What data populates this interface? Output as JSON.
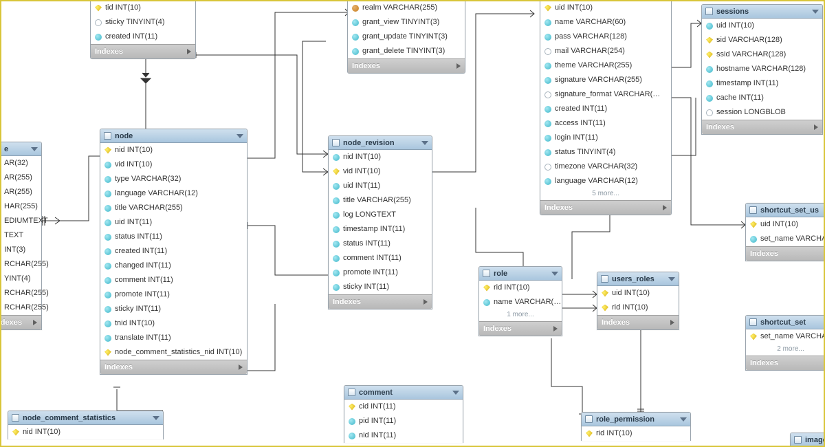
{
  "indexes_label": "Indexes",
  "tables": {
    "node_top": {
      "columns": [
        {
          "kind": "pk",
          "text": "tid INT(10)"
        },
        {
          "kind": "nul",
          "text": "sticky TINYINT(4)"
        },
        {
          "kind": "col",
          "text": "created INT(11)"
        }
      ]
    },
    "left_partial": {
      "title": "e",
      "columns": [
        {
          "kind": "col",
          "text": "AR(32)"
        },
        {
          "kind": "col",
          "text": "AR(255)"
        },
        {
          "kind": "col",
          "text": "AR(255)"
        },
        {
          "kind": "col",
          "text": "HAR(255)"
        },
        {
          "kind": "col",
          "text": "EDIUMTEXT"
        },
        {
          "kind": "col",
          "text": "TEXT"
        },
        {
          "kind": "col",
          "text": "INT(3)"
        },
        {
          "kind": "col",
          "text": "RCHAR(255)"
        },
        {
          "kind": "col",
          "text": "YINT(4)"
        },
        {
          "kind": "col",
          "text": "RCHAR(255)"
        },
        {
          "kind": "col",
          "text": "RCHAR(255)"
        }
      ]
    },
    "node": {
      "title": "node",
      "columns": [
        {
          "kind": "pk",
          "text": "nid INT(10)"
        },
        {
          "kind": "col",
          "text": "vid INT(10)"
        },
        {
          "kind": "col",
          "text": "type VARCHAR(32)"
        },
        {
          "kind": "col",
          "text": "language VARCHAR(12)"
        },
        {
          "kind": "col",
          "text": "title VARCHAR(255)"
        },
        {
          "kind": "col",
          "text": "uid INT(11)"
        },
        {
          "kind": "col",
          "text": "status INT(11)"
        },
        {
          "kind": "col",
          "text": "created INT(11)"
        },
        {
          "kind": "col",
          "text": "changed INT(11)"
        },
        {
          "kind": "col",
          "text": "comment INT(11)"
        },
        {
          "kind": "col",
          "text": "promote INT(11)"
        },
        {
          "kind": "col",
          "text": "sticky INT(11)"
        },
        {
          "kind": "col",
          "text": "tnid INT(10)"
        },
        {
          "kind": "col",
          "text": "translate INT(11)"
        },
        {
          "kind": "pk",
          "text": "node_comment_statistics_nid INT(10)"
        }
      ]
    },
    "ncs": {
      "title": "node_comment_statistics",
      "columns": [
        {
          "kind": "pk",
          "text": "nid INT(10)"
        }
      ]
    },
    "node_access_top": {
      "columns": [
        {
          "kind": "fk",
          "text": "realm VARCHAR(255)"
        },
        {
          "kind": "col",
          "text": "grant_view TINYINT(3)"
        },
        {
          "kind": "col",
          "text": "grant_update TINYINT(3)"
        },
        {
          "kind": "col",
          "text": "grant_delete TINYINT(3)"
        }
      ]
    },
    "node_revision": {
      "title": "node_revision",
      "columns": [
        {
          "kind": "col",
          "text": "nid INT(10)"
        },
        {
          "kind": "pk",
          "text": "vid INT(10)"
        },
        {
          "kind": "col",
          "text": "uid INT(11)"
        },
        {
          "kind": "col",
          "text": "title VARCHAR(255)"
        },
        {
          "kind": "col",
          "text": "log LONGTEXT"
        },
        {
          "kind": "col",
          "text": "timestamp INT(11)"
        },
        {
          "kind": "col",
          "text": "status INT(11)"
        },
        {
          "kind": "col",
          "text": "comment INT(11)"
        },
        {
          "kind": "col",
          "text": "promote INT(11)"
        },
        {
          "kind": "col",
          "text": "sticky INT(11)"
        }
      ]
    },
    "comment": {
      "title": "comment",
      "columns": [
        {
          "kind": "pk",
          "text": "cid INT(11)"
        },
        {
          "kind": "col",
          "text": "pid INT(11)"
        },
        {
          "kind": "col",
          "text": "nid INT(11)"
        }
      ]
    },
    "role": {
      "title": "role",
      "columns": [
        {
          "kind": "pk",
          "text": "rid INT(10)"
        },
        {
          "kind": "col",
          "text": "name VARCHAR(…"
        }
      ],
      "more": "1 more..."
    },
    "users_top": {
      "columns": [
        {
          "kind": "pk",
          "text": "uid INT(10)"
        },
        {
          "kind": "col",
          "text": "name VARCHAR(60)"
        },
        {
          "kind": "col",
          "text": "pass VARCHAR(128)"
        },
        {
          "kind": "nul",
          "text": "mail VARCHAR(254)"
        },
        {
          "kind": "col",
          "text": "theme VARCHAR(255)"
        },
        {
          "kind": "col",
          "text": "signature VARCHAR(255)"
        },
        {
          "kind": "nul",
          "text": "signature_format VARCHAR(…"
        },
        {
          "kind": "col",
          "text": "created INT(11)"
        },
        {
          "kind": "col",
          "text": "access INT(11)"
        },
        {
          "kind": "col",
          "text": "login INT(11)"
        },
        {
          "kind": "col",
          "text": "status TINYINT(4)"
        },
        {
          "kind": "nul",
          "text": "timezone VARCHAR(32)"
        },
        {
          "kind": "col",
          "text": "language VARCHAR(12)"
        }
      ],
      "more": "5 more..."
    },
    "users_roles": {
      "title": "users_roles",
      "columns": [
        {
          "kind": "pk",
          "text": "uid INT(10)"
        },
        {
          "kind": "pk",
          "text": "rid INT(10)"
        }
      ]
    },
    "role_permission": {
      "title": "role_permission",
      "columns": [
        {
          "kind": "pk",
          "text": "rid INT(10)"
        }
      ]
    },
    "sessions": {
      "title": "sessions",
      "columns": [
        {
          "kind": "col",
          "text": "uid INT(10)"
        },
        {
          "kind": "pk",
          "text": "sid VARCHAR(128)"
        },
        {
          "kind": "pk",
          "text": "ssid VARCHAR(128)"
        },
        {
          "kind": "col",
          "text": "hostname VARCHAR(128)"
        },
        {
          "kind": "col",
          "text": "timestamp INT(11)"
        },
        {
          "kind": "col",
          "text": "cache INT(11)"
        },
        {
          "kind": "nul",
          "text": "session LONGBLOB"
        }
      ]
    },
    "shortcut_set_users": {
      "title": "shortcut_set_us",
      "columns": [
        {
          "kind": "pk",
          "text": "uid INT(10)"
        },
        {
          "kind": "col",
          "text": "set_name VARCHAR"
        }
      ]
    },
    "shortcut_set": {
      "title": "shortcut_set",
      "columns": [
        {
          "kind": "pk",
          "text": "set_name VARCHA"
        }
      ],
      "more": "2 more..."
    },
    "image": {
      "title": "image_"
    }
  }
}
